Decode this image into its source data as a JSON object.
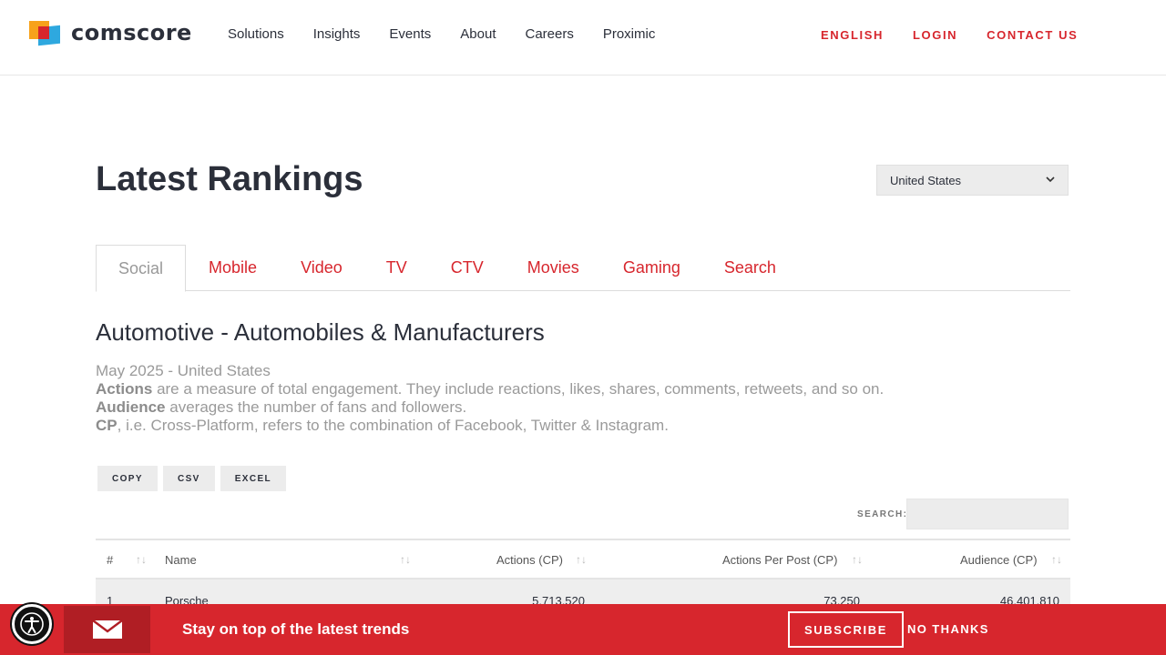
{
  "header": {
    "logo_text": "comscore",
    "nav": [
      "Solutions",
      "Insights",
      "Events",
      "About",
      "Careers",
      "Proximic"
    ],
    "util": [
      "ENGLISH",
      "LOGIN",
      "CONTACT US"
    ]
  },
  "page": {
    "title": "Latest Rankings",
    "country_selected": "United States"
  },
  "tabs": [
    "Social",
    "Mobile",
    "Video",
    "TV",
    "CTV",
    "Movies",
    "Gaming",
    "Search"
  ],
  "active_tab": "Social",
  "section": {
    "title": "Automotive - Automobiles & Manufacturers",
    "date_line": "May 2025 - United States",
    "actions_term": "Actions",
    "actions_desc": " are a measure of total engagement. They include reactions, likes, shares, comments, retweets, and so on.",
    "audience_term": "Audience",
    "audience_desc": " averages the number of fans and followers.",
    "cp_term": "CP",
    "cp_desc": ", i.e. Cross-Platform, refers to the combination of Facebook, Twitter & Instagram."
  },
  "export_buttons": [
    "COPY",
    "CSV",
    "EXCEL"
  ],
  "search_label": "SEARCH:",
  "table": {
    "headers": [
      "#",
      "Name",
      "Actions (CP)",
      "Actions Per Post (CP)",
      "Audience (CP)"
    ],
    "rows": [
      [
        "1",
        "Porsche",
        "5,713,520",
        "73,250",
        "46,401,810"
      ]
    ]
  },
  "banner": {
    "text": "Stay on top of the latest trends",
    "subscribe": "SUBSCRIBE",
    "no_thanks": "NO THANKS"
  },
  "colors": {
    "brand_red": "#d7262d",
    "dark_text": "#2b2f3a"
  }
}
